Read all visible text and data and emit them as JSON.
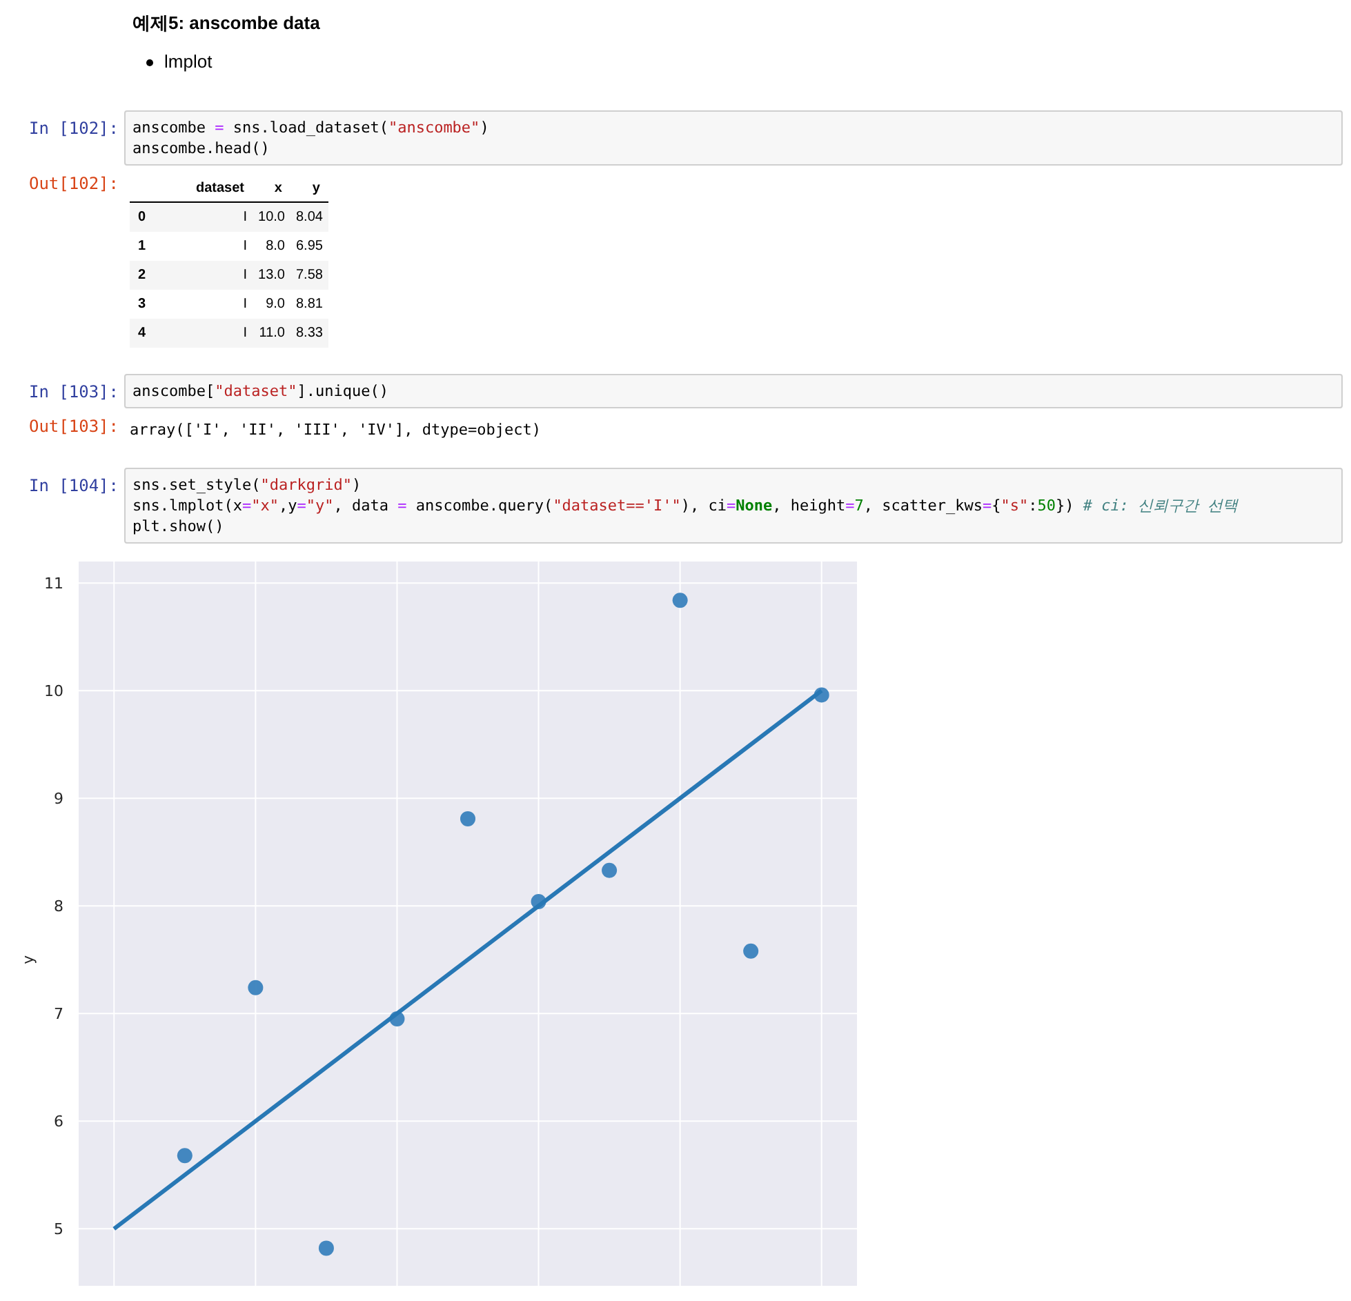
{
  "markdown": {
    "heading": "예제5: anscombe data",
    "bullets": [
      "lmplot"
    ]
  },
  "cells": [
    {
      "prompt": "In [102]:",
      "lines": [
        [
          {
            "kind": "plain",
            "text": "anscombe "
          },
          {
            "kind": "op",
            "text": "="
          },
          {
            "kind": "plain",
            "text": " sns.load_dataset("
          },
          {
            "kind": "str",
            "text": "\"anscombe\""
          },
          {
            "kind": "plain",
            "text": ")"
          }
        ],
        [
          {
            "kind": "plain",
            "text": "anscombe.head()"
          }
        ]
      ],
      "output": {
        "prompt": "Out[102]:",
        "kind": "table",
        "columns": [
          "",
          "dataset",
          "x",
          "y"
        ],
        "rows": [
          [
            "0",
            "I",
            "10.0",
            "8.04"
          ],
          [
            "1",
            "I",
            "8.0",
            "6.95"
          ],
          [
            "2",
            "I",
            "13.0",
            "7.58"
          ],
          [
            "3",
            "I",
            "9.0",
            "8.81"
          ],
          [
            "4",
            "I",
            "11.0",
            "8.33"
          ]
        ]
      }
    },
    {
      "prompt": "In [103]:",
      "lines": [
        [
          {
            "kind": "plain",
            "text": "anscombe["
          },
          {
            "kind": "str",
            "text": "\"dataset\""
          },
          {
            "kind": "plain",
            "text": "].unique()"
          }
        ]
      ],
      "output": {
        "prompt": "Out[103]:",
        "kind": "text",
        "text": "array(['I', 'II', 'III', 'IV'], dtype=object)"
      }
    },
    {
      "prompt": "In [104]:",
      "lines": [
        [
          {
            "kind": "plain",
            "text": "sns.set_style("
          },
          {
            "kind": "str",
            "text": "\"darkgrid\""
          },
          {
            "kind": "plain",
            "text": ")"
          }
        ],
        [
          {
            "kind": "plain",
            "text": "sns.lmplot(x"
          },
          {
            "kind": "op",
            "text": "="
          },
          {
            "kind": "str",
            "text": "\"x\""
          },
          {
            "kind": "plain",
            "text": ",y"
          },
          {
            "kind": "op",
            "text": "="
          },
          {
            "kind": "str",
            "text": "\"y\""
          },
          {
            "kind": "plain",
            "text": ", data "
          },
          {
            "kind": "op",
            "text": "="
          },
          {
            "kind": "plain",
            "text": " anscombe.query("
          },
          {
            "kind": "str",
            "text": "\"dataset=='I'\""
          },
          {
            "kind": "plain",
            "text": "), ci"
          },
          {
            "kind": "op",
            "text": "="
          },
          {
            "kind": "kw",
            "text": "None"
          },
          {
            "kind": "plain",
            "text": ", height"
          },
          {
            "kind": "op",
            "text": "="
          },
          {
            "kind": "num",
            "text": "7"
          },
          {
            "kind": "plain",
            "text": ", scatter_kws"
          },
          {
            "kind": "op",
            "text": "="
          },
          {
            "kind": "plain",
            "text": "{"
          },
          {
            "kind": "str",
            "text": "\"s\""
          },
          {
            "kind": "plain",
            "text": ":"
          },
          {
            "kind": "num",
            "text": "50"
          },
          {
            "kind": "plain",
            "text": "}) "
          },
          {
            "kind": "comment",
            "text": "# ci: 신뢰구간 선택"
          }
        ],
        [
          {
            "kind": "plain",
            "text": "plt.show()"
          }
        ]
      ],
      "output": {
        "kind": "plot",
        "ylabel": "y",
        "ytick_labels": [
          "11",
          "10",
          "9",
          "8",
          "7",
          "6",
          "5"
        ]
      }
    }
  ]
}
